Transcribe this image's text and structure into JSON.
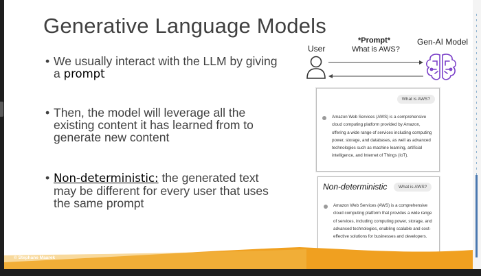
{
  "slide": {
    "title": "Generative Language Models",
    "bullets": [
      {
        "pre": "We usually interact with the LLM by giving a ",
        "em": "prompt",
        "post": ""
      },
      {
        "text": "Then, the model will leverage all the existing content it has learned from to generate new content"
      },
      {
        "em": "Non-deterministic:",
        "post": " the generated text may be different for every user that uses the same prompt"
      }
    ],
    "diagram": {
      "user_label": "User",
      "prompt_title": "*Prompt*",
      "prompt_text": "What is AWS?",
      "model_label": "Gen-AI Model"
    },
    "response1": {
      "question": "What is AWS?",
      "answer": "Amazon Web Services (AWS) is a comprehensive cloud computing platform provided by Amazon, offering a wide range of services including computing power, storage, and databases, as well as advanced technologies such as machine learning, artificial intelligence, and Internet of Things (IoT)."
    },
    "response2": {
      "label": "Non-deterministic",
      "question": "What is AWS?",
      "answer": "Amazon Web Services (AWS) is a comprehensive cloud computing platform that provides a wide range of services, including computing power, storage, and advanced technologies, enabling scalable and cost-effective solutions for businesses and developers."
    },
    "footer": {
      "copyright": "© Stephane Maarek"
    }
  },
  "colors": {
    "accent_orange": "#f0a020",
    "title_gray": "#404040",
    "icon_purple": "#7a3fc8"
  },
  "icons": [
    "user-icon",
    "brain-icon"
  ]
}
